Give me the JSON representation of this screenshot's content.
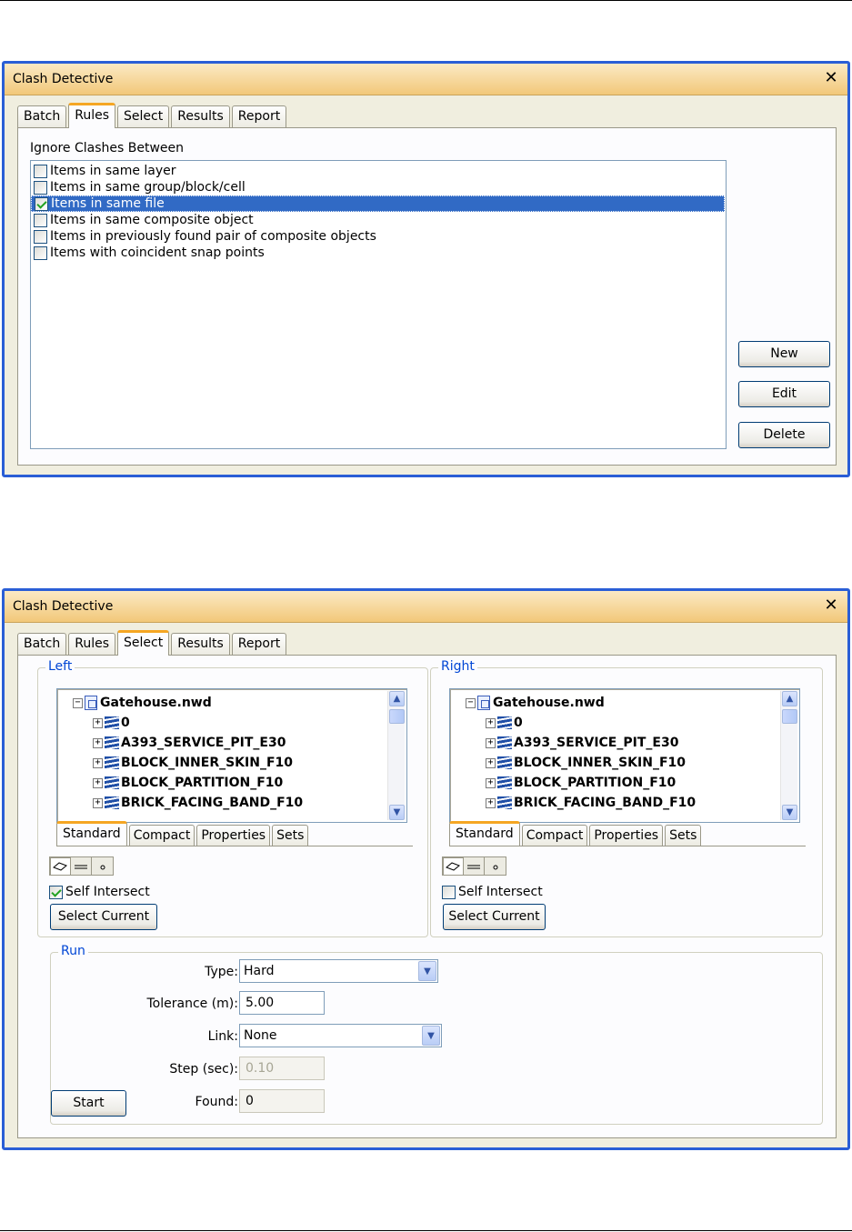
{
  "dialog_rules": {
    "title": "Clash Detective",
    "close_symbol": "✕",
    "tabs": [
      "Batch",
      "Rules",
      "Select",
      "Results",
      "Report"
    ],
    "active_tab": "Rules",
    "heading": "Ignore Clashes Between",
    "rules": [
      {
        "label": "Items in same layer",
        "checked": false,
        "selected": false
      },
      {
        "label": "Items in same group/block/cell",
        "checked": false,
        "selected": false
      },
      {
        "label": "Items in same file",
        "checked": true,
        "selected": true
      },
      {
        "label": "Items in same composite object",
        "checked": false,
        "selected": false
      },
      {
        "label": "Items in previously found pair of composite objects",
        "checked": false,
        "selected": false
      },
      {
        "label": "Items with coincident snap points",
        "checked": false,
        "selected": false
      }
    ],
    "buttons": {
      "new": "New",
      "edit": "Edit",
      "delete": "Delete"
    }
  },
  "dialog_select": {
    "title": "Clash Detective",
    "close_symbol": "✕",
    "tabs": [
      "Batch",
      "Rules",
      "Select",
      "Results",
      "Report"
    ],
    "active_tab": "Select",
    "left": {
      "legend": "Left",
      "tree_root": "Gatehouse.nwd",
      "tree_items": [
        "0",
        "A393_SERVICE_PIT_E30",
        "BLOCK_INNER_SKIN_F10",
        "BLOCK_PARTITION_F10",
        "BRICK_FACING_BAND_F10"
      ],
      "subtabs": [
        "Standard",
        "Compact",
        "Properties",
        "Sets"
      ],
      "active_subtab": "Standard",
      "self_intersect_label": "Self Intersect",
      "self_intersect_checked": true,
      "select_current_label": "Select Current"
    },
    "right": {
      "legend": "Right",
      "tree_root": "Gatehouse.nwd",
      "tree_items": [
        "0",
        "A393_SERVICE_PIT_E30",
        "BLOCK_INNER_SKIN_F10",
        "BLOCK_PARTITION_F10",
        "BRICK_FACING_BAND_F10"
      ],
      "subtabs": [
        "Standard",
        "Compact",
        "Properties",
        "Sets"
      ],
      "active_subtab": "Standard",
      "self_intersect_label": "Self Intersect",
      "self_intersect_checked": false,
      "select_current_label": "Select Current"
    },
    "run": {
      "legend": "Run",
      "type_label": "Type:",
      "type_value": "Hard",
      "tolerance_label": "Tolerance (m):",
      "tolerance_value": "5.00",
      "link_label": "Link:",
      "link_value": "None",
      "step_label": "Step (sec):",
      "step_value": "0.10",
      "found_label": "Found:",
      "found_value": "0",
      "start_label": "Start"
    }
  },
  "icons": {
    "expand": "+",
    "collapse": "−",
    "scroll_up": "▲",
    "scroll_down": "▼",
    "dropdown": "▼"
  },
  "colors": {
    "window_border": "#2a5ed6",
    "title_gradient_top": "#fbe9c4",
    "title_gradient_bottom": "#f2c879",
    "tab_accent": "#f5a623",
    "selection": "#316ac5",
    "legend_text": "#0046d5"
  }
}
